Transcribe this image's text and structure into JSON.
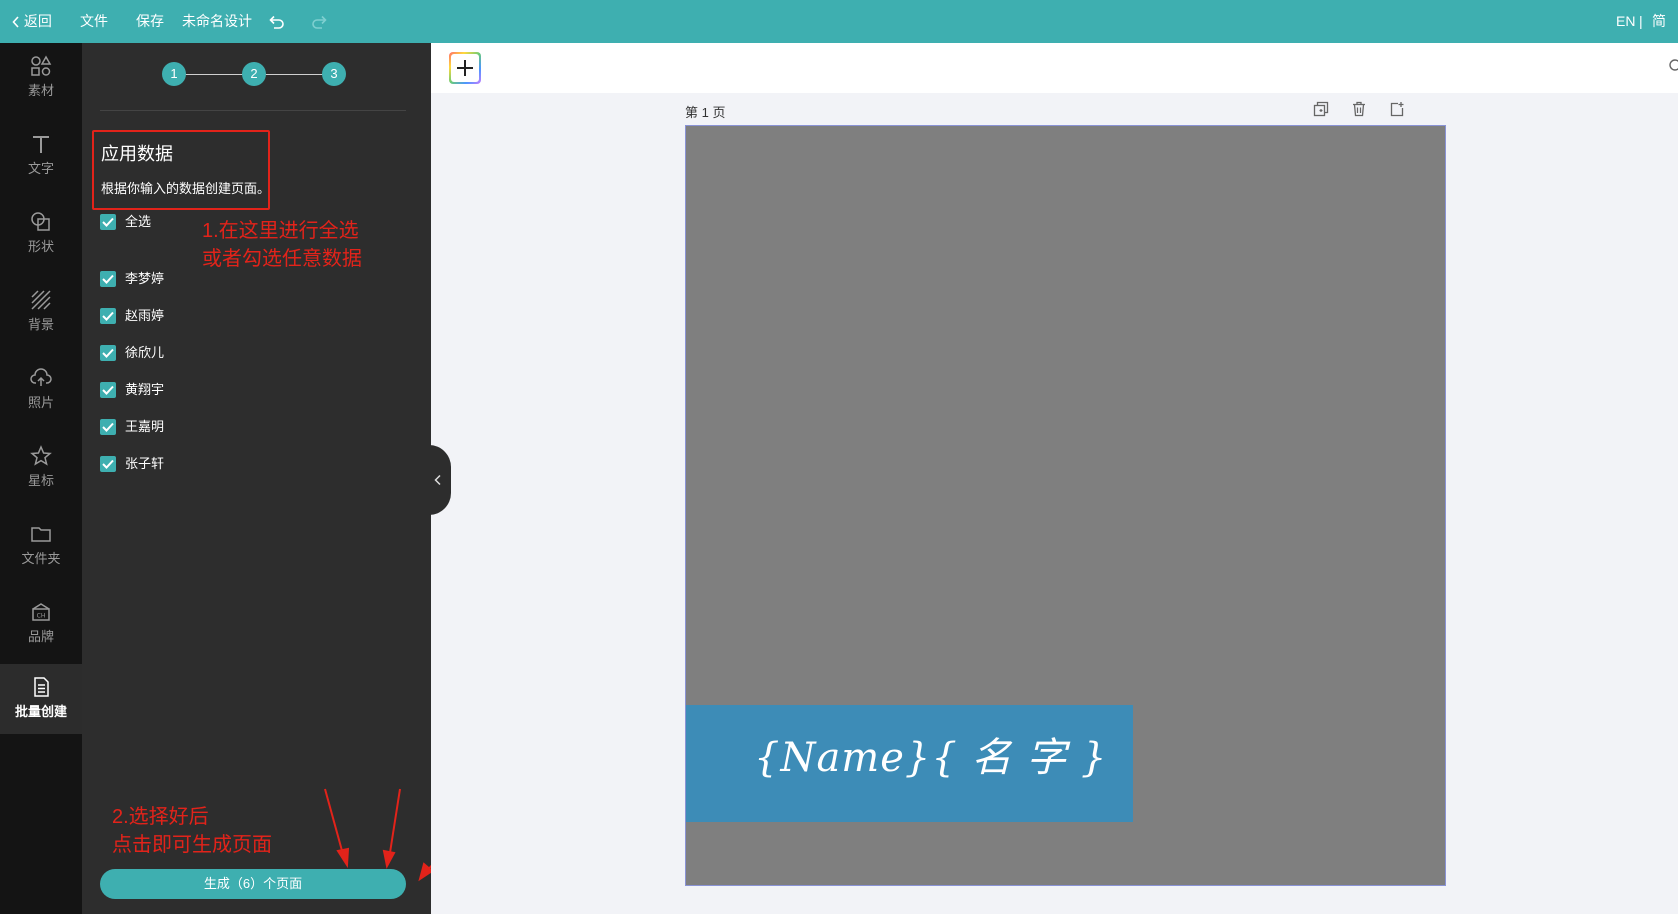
{
  "topbar": {
    "back": "返回",
    "file": "文件",
    "save": "保存",
    "title": "未命名设计",
    "lang": "EN",
    "sep": "|",
    "script": "简"
  },
  "rail": [
    {
      "label": "素材",
      "icon": "shapes-icon"
    },
    {
      "label": "文字",
      "icon": "text-icon"
    },
    {
      "label": "形状",
      "icon": "shape-icon"
    },
    {
      "label": "背景",
      "icon": "background-icon"
    },
    {
      "label": "照片",
      "icon": "upload-photo-icon"
    },
    {
      "label": "星标",
      "icon": "star-icon"
    },
    {
      "label": "文件夹",
      "icon": "folder-icon"
    },
    {
      "label": "品牌",
      "icon": "brand-icon"
    },
    {
      "label": "批量创建",
      "icon": "batch-create-icon"
    }
  ],
  "steps": [
    "1",
    "2",
    "3"
  ],
  "panel": {
    "title": "应用数据",
    "desc": "根据你输入的数据创建页面。",
    "select_all": "全选",
    "items": [
      "李梦婷",
      "赵雨婷",
      "徐欣儿",
      "黄翔宇",
      "王嘉明",
      "张子轩"
    ],
    "note1_line1": "1.在这里进行全选",
    "note1_line2": "或者勾选任意数据",
    "note2_line1": "2.选择好后",
    "note2_line2": "点击即可生成页面",
    "generate": "生成（6）个页面"
  },
  "canvas": {
    "page_label": "第 1 页",
    "banner_text": "{Name}{ 名 字 }"
  },
  "colors": {
    "accent": "#3eafb0",
    "annotation": "#e2231a",
    "banner": "#3d8cb7",
    "page": "#7f7f7f"
  }
}
